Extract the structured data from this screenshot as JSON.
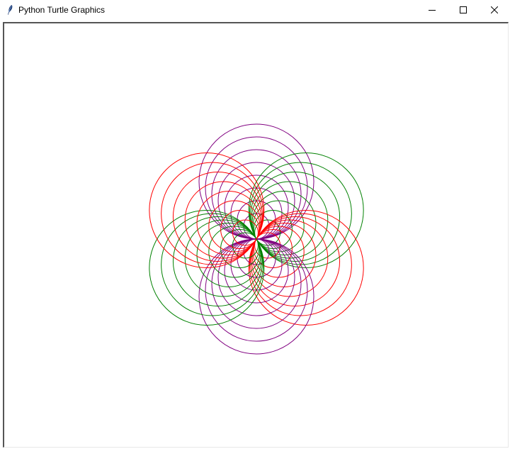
{
  "window": {
    "title": "Python Turtle Graphics",
    "app_icon": "feather-icon",
    "controls": {
      "minimize_icon": "minimize-icon",
      "maximize_icon": "maximize-icon",
      "close_icon": "close-icon"
    }
  },
  "drawing": {
    "background_color": "#ffffff",
    "pattern": "spirograph rosette of nested circles",
    "colors": [
      "#ff0000",
      "#800080",
      "#008000"
    ],
    "petal_count": 6,
    "rings_per_petal": 8
  }
}
